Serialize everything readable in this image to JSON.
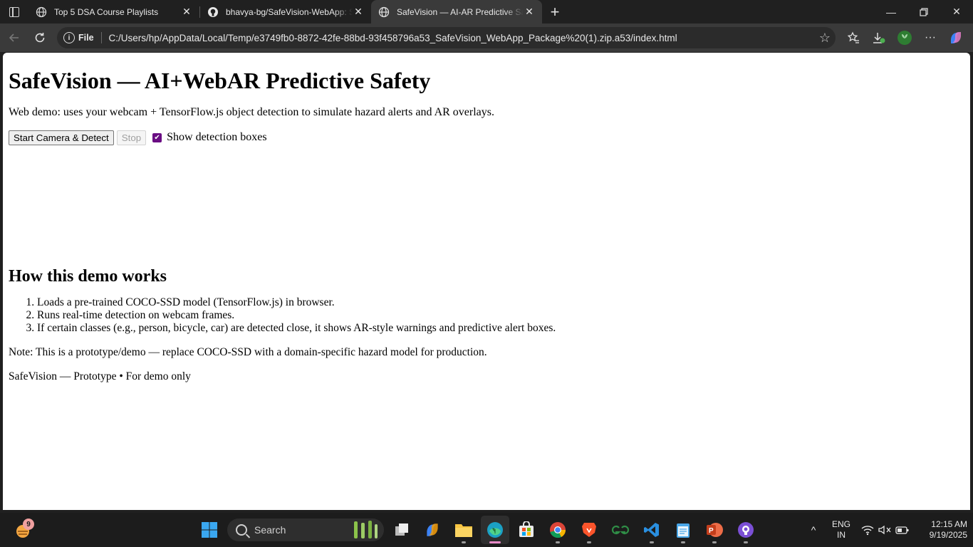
{
  "browser": {
    "tabs": [
      {
        "title": "Top 5 DSA Course Playlists",
        "icon": "globe-icon",
        "active": false
      },
      {
        "title": "bhavya-bg/SafeVision-WebApp: S",
        "icon": "github-icon",
        "active": false
      },
      {
        "title": "SafeVision — AI-AR Predictive Saf",
        "icon": "globe-icon",
        "active": true
      }
    ],
    "address": {
      "scheme_label": "File",
      "url": "C:/Users/hp/AppData/Local/Temp/e3749fb0-8872-42fe-88bd-93f458796a53_SafeVision_WebApp_Package%20(1).zip.a53/index.html"
    }
  },
  "page": {
    "title": "SafeVision — AI+WebAR Predictive Safety",
    "subtitle": "Web demo: uses your webcam + TensorFlow.js object detection to simulate hazard alerts and AR overlays.",
    "controls": {
      "start_label": "Start Camera & Detect",
      "stop_label": "Stop",
      "show_boxes_label": "Show detection boxes",
      "show_boxes_checked": true
    },
    "how_heading": "How this demo works",
    "steps": [
      "Loads a pre-trained COCO-SSD model (TensorFlow.js) in browser.",
      "Runs real-time detection on webcam frames.",
      "If certain classes (e.g., person, bicycle, car) are detected close, it shows AR-style warnings and predictive alert boxes."
    ],
    "note": "Note: This is a prototype/demo — replace COCO-SSD with a domain-specific hazard model for production.",
    "footer": "SafeVision — Prototype • For demo only"
  },
  "taskbar": {
    "search_placeholder": "Search",
    "notification_badge": "9",
    "language": "ENG",
    "region": "IN",
    "time": "12:15 AM",
    "date": "9/19/2025"
  },
  "colors": {
    "checkbox_accent": "#6a0d83",
    "active_tab": "#3a3a3a",
    "titlebar": "#202020"
  }
}
